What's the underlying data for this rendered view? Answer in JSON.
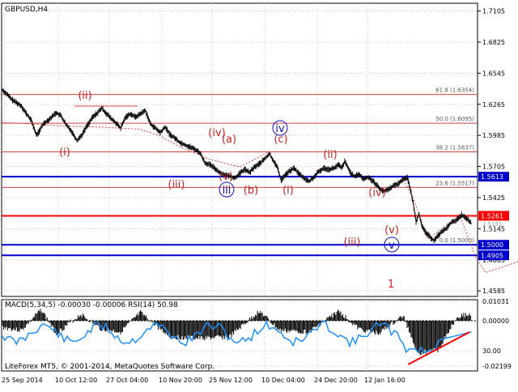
{
  "header": {
    "symbol_title": "GBPUSD,H4",
    "indicator_title": "MACD(5,34,5) -0.00030 -0.00006 RSI(14) 50.98",
    "copyright": "LiteForex MT5, © 2001-2014, MetaQuotes Software Corp."
  },
  "chart_data": [
    {
      "type": "line",
      "name": "GBPUSD H4 price",
      "x_tick_labels": [
        "25 Sep 2014",
        "10 Oct 12:00",
        "27 Oct 04:00",
        "10 Nov 20:00",
        "25 Nov 12:00",
        "10 Dec 04:00",
        "24 Dec 20:00",
        "12 Jan 16:00"
      ],
      "ylim": [
        1.4535,
        1.7175
      ],
      "y_ticks": [
        1.7105,
        1.6825,
        1.6545,
        1.6265,
        1.5985,
        1.5705,
        1.5425,
        1.5145,
        1.4865,
        1.4585
      ],
      "y_tick_labels": [
        "1.7105",
        "1.6825",
        "1.6545",
        "1.6265",
        "1.5985",
        "1.5705",
        "1.5425",
        "1.5145",
        "1.4865",
        "1.4585"
      ],
      "series_color": "#000000",
      "price_path": [
        [
          0,
          1.64
        ],
        [
          5,
          1.636
        ],
        [
          10,
          1.631
        ],
        [
          15,
          1.628
        ],
        [
          20,
          1.625
        ],
        [
          25,
          1.618
        ],
        [
          30,
          1.612
        ],
        [
          35,
          1.599
        ],
        [
          38,
          1.602
        ],
        [
          42,
          1.609
        ],
        [
          48,
          1.613
        ],
        [
          55,
          1.619
        ],
        [
          60,
          1.616
        ],
        [
          65,
          1.608
        ],
        [
          70,
          1.603
        ],
        [
          76,
          1.594
        ],
        [
          81,
          1.599
        ],
        [
          86,
          1.607
        ],
        [
          92,
          1.615
        ],
        [
          97,
          1.619
        ],
        [
          101,
          1.623
        ],
        [
          106,
          1.618
        ],
        [
          110,
          1.614
        ],
        [
          115,
          1.61
        ],
        [
          120,
          1.605
        ],
        [
          125,
          1.615
        ],
        [
          130,
          1.618
        ],
        [
          135,
          1.615
        ],
        [
          140,
          1.618
        ],
        [
          145,
          1.621
        ],
        [
          150,
          1.609
        ],
        [
          155,
          1.605
        ],
        [
          160,
          1.601
        ],
        [
          165,
          1.606
        ],
        [
          170,
          1.599
        ],
        [
          175,
          1.596
        ],
        [
          180,
          1.592
        ],
        [
          185,
          1.59
        ],
        [
          190,
          1.588
        ],
        [
          195,
          1.586
        ],
        [
          200,
          1.583
        ],
        [
          205,
          1.574
        ],
        [
          210,
          1.572
        ],
        [
          215,
          1.569
        ],
        [
          220,
          1.565
        ],
        [
          225,
          1.563
        ],
        [
          230,
          1.562
        ],
        [
          235,
          1.56
        ],
        [
          240,
          1.564
        ],
        [
          245,
          1.568
        ],
        [
          250,
          1.565
        ],
        [
          255,
          1.57
        ],
        [
          260,
          1.573
        ],
        [
          265,
          1.577
        ],
        [
          270,
          1.582
        ],
        [
          274,
          1.576
        ],
        [
          278,
          1.57
        ],
        [
          280,
          1.564
        ],
        [
          282,
          1.558
        ],
        [
          285,
          1.562
        ],
        [
          290,
          1.566
        ],
        [
          295,
          1.569
        ],
        [
          300,
          1.564
        ],
        [
          305,
          1.56
        ],
        [
          310,
          1.557
        ],
        [
          315,
          1.561
        ],
        [
          320,
          1.566
        ],
        [
          325,
          1.569
        ],
        [
          330,
          1.568
        ],
        [
          335,
          1.569
        ],
        [
          340,
          1.572
        ],
        [
          343,
          1.569
        ],
        [
          346,
          1.575
        ],
        [
          349,
          1.57
        ],
        [
          352,
          1.565
        ],
        [
          356,
          1.561
        ],
        [
          360,
          1.564
        ],
        [
          365,
          1.559
        ],
        [
          370,
          1.561
        ],
        [
          375,
          1.557
        ],
        [
          380,
          1.552
        ],
        [
          385,
          1.548
        ],
        [
          390,
          1.55
        ],
        [
          395,
          1.553
        ],
        [
          400,
          1.555
        ],
        [
          405,
          1.559
        ],
        [
          409,
          1.561
        ],
        [
          412,
          1.551
        ],
        [
          415,
          1.538
        ],
        [
          418,
          1.521
        ],
        [
          421,
          1.528
        ],
        [
          424,
          1.516
        ],
        [
          428,
          1.511
        ],
        [
          432,
          1.507
        ],
        [
          436,
          1.504
        ],
        [
          440,
          1.508
        ],
        [
          444,
          1.512
        ],
        [
          448,
          1.514
        ],
        [
          452,
          1.519
        ],
        [
          456,
          1.521
        ],
        [
          460,
          1.523
        ],
        [
          464,
          1.527
        ],
        [
          468,
          1.524
        ],
        [
          471,
          1.522
        ],
        [
          474,
          1.519
        ]
      ]
    },
    {
      "type": "line",
      "name": "MACD / RSI panel",
      "y_ticks": [
        0.0103,
        0.0,
        -0.02199
      ],
      "y_tick_labels": [
        "0.01031",
        "0.00000",
        "30.00",
        "-0.02199"
      ],
      "rsi_level": 30,
      "rsi_color": "#1e90ff",
      "macd_color": "#000000",
      "signal_color": "#ff0000"
    }
  ],
  "levels": [
    {
      "price": 1.6354,
      "label": "61.8 (1.6354)",
      "color": "#d04040",
      "width": 1
    },
    {
      "price": 1.6095,
      "label": "50.0 (1.6095)",
      "color": "#d04040",
      "width": 1
    },
    {
      "price": 1.5837,
      "label": "38.2 (1.5837)",
      "color": "#d04040",
      "width": 1
    },
    {
      "price": 1.5517,
      "label": "23.6 (1.5517)",
      "color": "#d04040",
      "width": 1
    },
    {
      "price": 1.5,
      "label": "0.0 (1.5000)",
      "color": "#d04040",
      "width": 1
    }
  ],
  "horizontal_lines": [
    {
      "price": 1.5613,
      "label": "1.5613",
      "color": "#0000cc",
      "width": 2
    },
    {
      "price": 1.5261,
      "label": "1.5261",
      "color": "#ff0000",
      "width": 2
    },
    {
      "price": 1.5,
      "label": "1.5000",
      "color": "#0000cc",
      "width": 2
    },
    {
      "price": 1.4905,
      "label": "1.4905",
      "color": "#0000cc",
      "width": 2
    }
  ],
  "wave_labels": [
    {
      "text": "(i)",
      "color": "#d02020",
      "circled": false
    },
    {
      "text": "(ii)",
      "color": "#d02020",
      "circled": false
    },
    {
      "text": "(iii)",
      "color": "#d02020",
      "circled": false
    },
    {
      "text": "(iv)",
      "color": "#d02020",
      "circled": false
    },
    {
      "text": "(v)",
      "color": "#d02020",
      "circled": false
    },
    {
      "text": "iii",
      "color": "#1010c0",
      "circled": true
    },
    {
      "text": "(a)",
      "color": "#d02020",
      "circled": false
    },
    {
      "text": "(b)",
      "color": "#d02020",
      "circled": false
    },
    {
      "text": "(c)",
      "color": "#d02020",
      "circled": false
    },
    {
      "text": "iv",
      "color": "#1010c0",
      "circled": true
    },
    {
      "text": "(i)",
      "color": "#d02020",
      "circled": false
    },
    {
      "text": "(ii)",
      "color": "#d02020",
      "circled": false
    },
    {
      "text": "(iii)",
      "color": "#d02020",
      "circled": false
    },
    {
      "text": "(iv)",
      "color": "#d02020",
      "circled": false
    },
    {
      "text": "(v)",
      "color": "#d02020",
      "circled": false
    },
    {
      "text": "v",
      "color": "#1010c0",
      "circled": true
    },
    {
      "text": "1",
      "color": "#d02020",
      "circled": false
    }
  ],
  "extra_price_label": "1.5191",
  "colors": {
    "background": "#ffffff",
    "grid": "#c8c8c8",
    "axis_text": "#000000",
    "projection": "#e04040"
  }
}
